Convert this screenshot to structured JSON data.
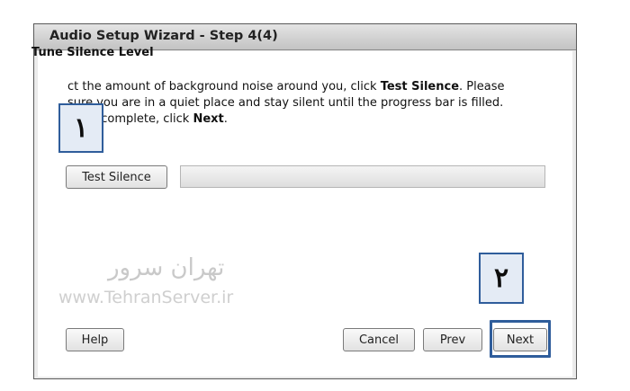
{
  "window": {
    "title": "Audio Setup Wizard - Step 4(4)"
  },
  "section": {
    "title": "Tune Silence Level"
  },
  "instructions": {
    "line1_pre": "ct the amount of background noise around you, click ",
    "line1_bold": "Test Silence",
    "line1_post": ". Please",
    "line2": "sure you are in a quiet place and stay silent until the progress bar is filled.",
    "line3_pre": "his is complete, click ",
    "line3_bold": "Next",
    "line3_post": "."
  },
  "test_silence": {
    "label": "Test Silence"
  },
  "progress": {
    "value_percent": 0
  },
  "callouts": {
    "first": "١",
    "second": "٢"
  },
  "watermark": {
    "farsi": "تهران سرور",
    "url": "www.TehranServer.ir"
  },
  "buttons": {
    "help": "Help",
    "cancel": "Cancel",
    "prev": "Prev",
    "next": "Next"
  },
  "colors": {
    "callout_border": "#2f5d9b",
    "callout_fill": "#e4ebf5"
  }
}
